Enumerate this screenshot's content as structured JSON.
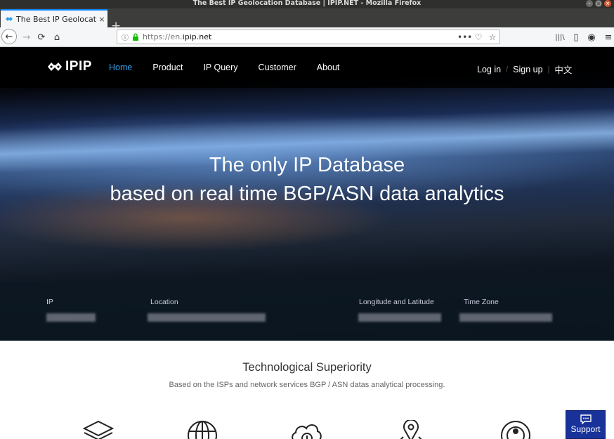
{
  "window": {
    "title": "The Best IP Geolocation Database | IPIP.NET - Mozilla Firefox",
    "controls": [
      "–",
      "▢",
      "×"
    ]
  },
  "browser": {
    "tab_title": "The Best IP Geolocation D",
    "tab_close": "×",
    "new_tab": "+",
    "url_prefix": "https://en.",
    "url_domain": "ipip.net",
    "nav": {
      "back": "←",
      "forward": "→",
      "reload": "⟳",
      "home": "⌂"
    },
    "url_actions": [
      "•••",
      "♡",
      "☆"
    ],
    "toolbar_icons": [
      "|||\\",
      "▯",
      "◉",
      "≡"
    ]
  },
  "site": {
    "logo": "IPIP",
    "menu": [
      {
        "label": "Home",
        "active": true
      },
      {
        "label": "Product",
        "active": false
      },
      {
        "label": "IP Query",
        "active": false
      },
      {
        "label": "Customer",
        "active": false
      },
      {
        "label": "About",
        "active": false
      }
    ],
    "auth": {
      "login": "Log in",
      "separator": "/",
      "signup": "Sign up",
      "language": "中文"
    },
    "hero": {
      "line1": "The only IP Database",
      "line2": "based on real time BGP/ASN data analytics"
    },
    "lookup": {
      "ip_label": "IP",
      "location_label": "Location",
      "latlong_label": "Longitude and Latitude",
      "timezone_label": "Time Zone"
    },
    "features": {
      "title": "Technological Superiority",
      "subtitle": "Based on the ISPs and network services BGP / ASN datas analytical processing.",
      "icons": [
        "layers-icon",
        "globe-icon",
        "cloud-icon",
        "map-pin-icon",
        "target-icon"
      ]
    },
    "support_label": "Support"
  },
  "colors": {
    "accent": "#2e9fe8",
    "support_bg": "#18329a",
    "firefox_blue": "#0a84ff"
  }
}
